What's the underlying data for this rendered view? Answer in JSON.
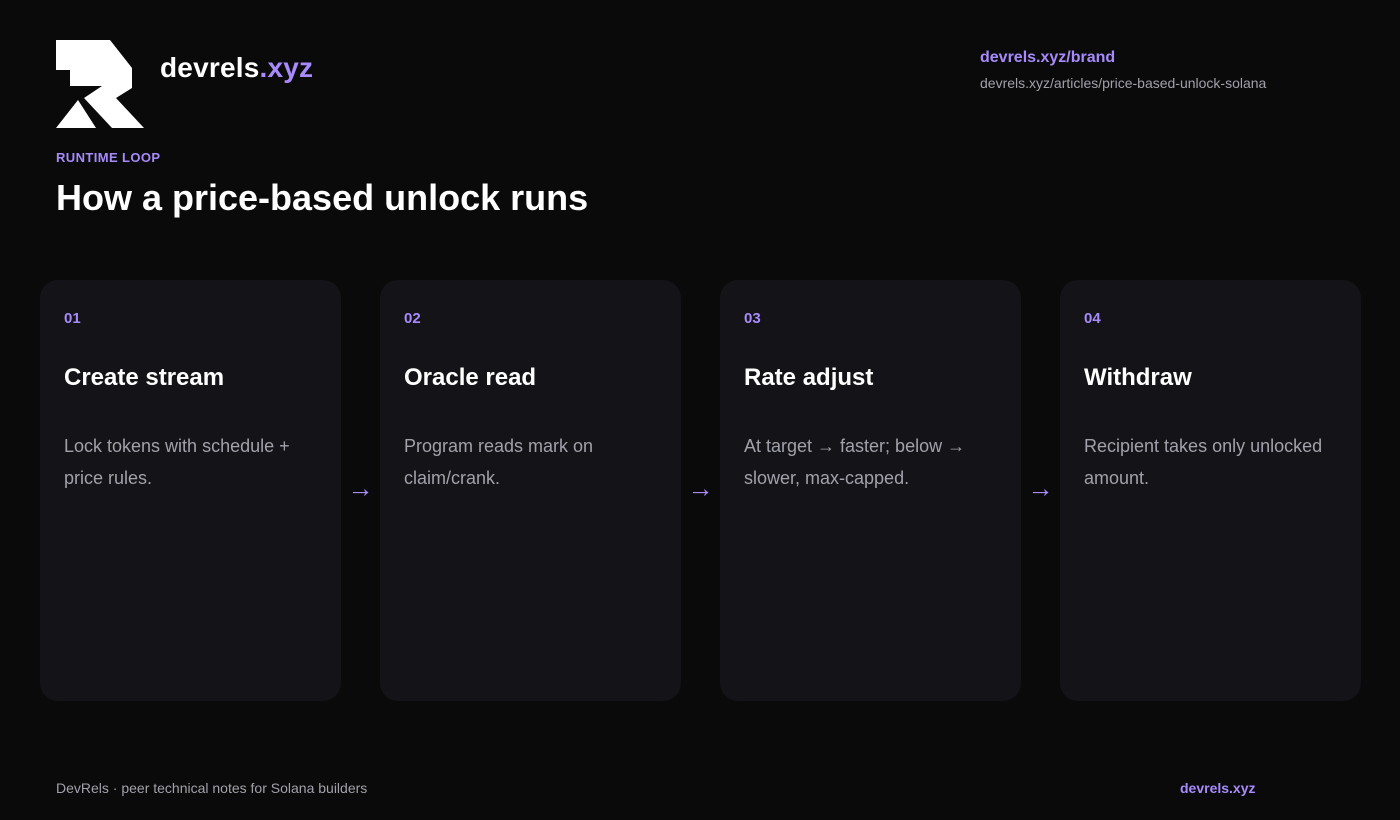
{
  "brand": {
    "name_main": "devrels",
    "name_accent": ".xyz",
    "logo_icon": "devrels-logo-icon",
    "accent_color": "#a78bfa"
  },
  "reference": {
    "link": "devrels.xyz/brand",
    "url": "devrels.xyz/articles/price-based-unlock-solana"
  },
  "header": {
    "eyebrow": "RUNTIME LOOP",
    "title": "How a price-based unlock runs"
  },
  "steps": [
    {
      "num": "01",
      "title": "Create stream",
      "desc": "Lock tokens with schedule + price rules."
    },
    {
      "num": "02",
      "title": "Oracle read",
      "desc": "Program reads mark on claim/crank."
    },
    {
      "num": "03",
      "title": "Rate adjust",
      "desc": "At target → faster; below → slower, max-capped."
    },
    {
      "num": "04",
      "title": "Withdraw",
      "desc": "Recipient takes only unlocked amount."
    }
  ],
  "arrow_glyph": "→",
  "footer": {
    "left": "DevRels · peer technical notes for Solana builders",
    "right": "devrels.xyz"
  }
}
